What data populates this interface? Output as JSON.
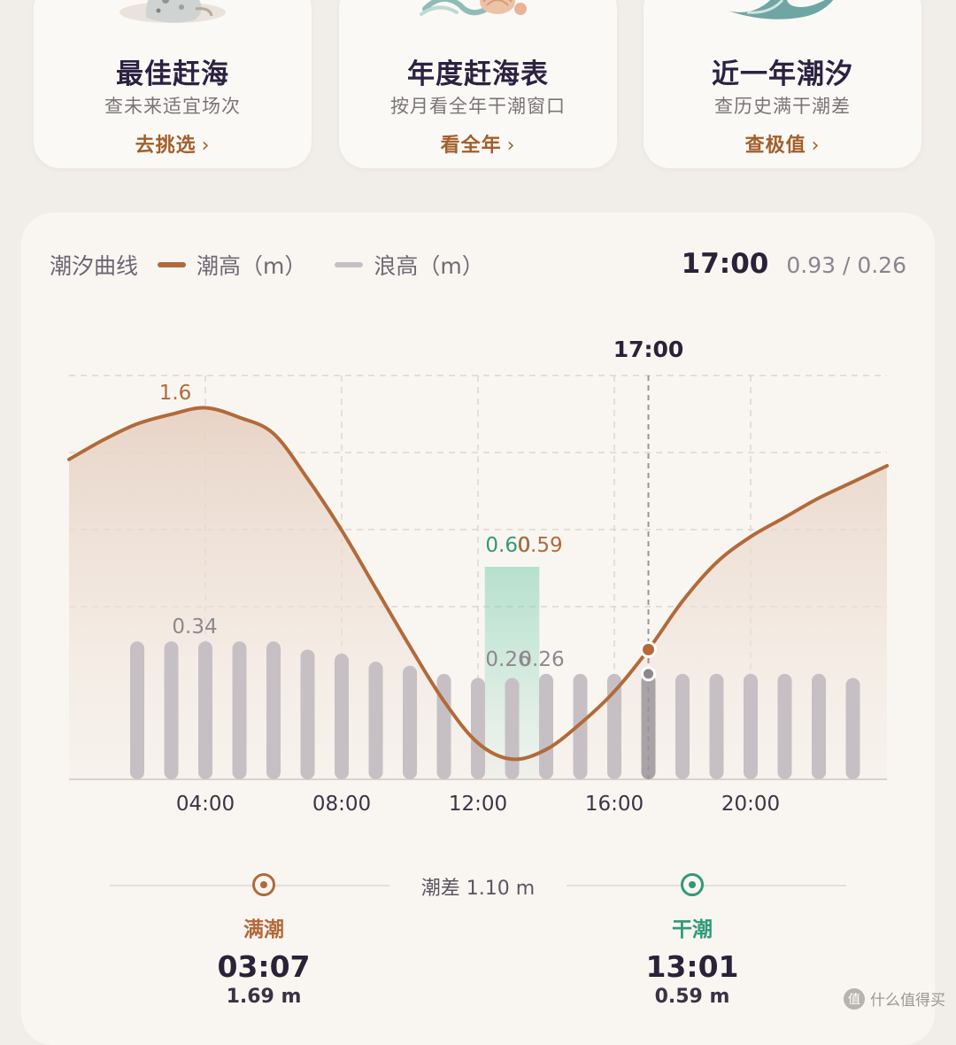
{
  "colors": {
    "tide": "#b26a3a",
    "wave": "#c6c0c4",
    "low": "#2f9a78",
    "high_text": "#a35f2b",
    "grid": "#dcd5ce"
  },
  "cards": [
    {
      "icon": "rock-icon",
      "title": "最佳赶海",
      "desc": "查未来适宜场次",
      "link": "去挑选",
      "chevron": "›"
    },
    {
      "icon": "shell-icon",
      "title": "年度赶海表",
      "desc": "按月看全年干潮窗口",
      "link": "看全年",
      "chevron": "›"
    },
    {
      "icon": "wave-icon",
      "title": "近一年潮汐",
      "desc": "查历史满干潮差",
      "link": "查极值",
      "chevron": "›"
    }
  ],
  "chart_header": {
    "title": "潮汐曲线",
    "legend_tide": "潮高（m）",
    "legend_wave": "浪高（m）",
    "time": "17:00",
    "values": "0.93 / 0.26"
  },
  "chart_data": {
    "type": "line",
    "x_ticks": [
      "04:00",
      "08:00",
      "12:00",
      "16:00",
      "20:00"
    ],
    "cursor_label": "17:00",
    "series": [
      {
        "name": "潮高（m）",
        "hours": [
          0,
          1,
          2,
          3,
          4,
          5,
          6,
          7,
          8,
          9,
          10,
          11,
          12,
          13,
          14,
          15,
          16,
          17,
          18,
          19,
          20,
          21,
          22,
          23,
          24
        ],
        "values": [
          1.52,
          1.58,
          1.63,
          1.66,
          1.68,
          1.65,
          1.6,
          1.46,
          1.3,
          1.12,
          0.94,
          0.77,
          0.64,
          0.59,
          0.62,
          0.7,
          0.8,
          0.93,
          1.08,
          1.2,
          1.28,
          1.34,
          1.4,
          1.45,
          1.5
        ]
      },
      {
        "name": "浪高（m）",
        "type": "bar",
        "hours": [
          2,
          3,
          4,
          5,
          6,
          7,
          8,
          9,
          10,
          11,
          12,
          13,
          14,
          15,
          16,
          17,
          18,
          19,
          20,
          21,
          22,
          23
        ],
        "values": [
          0.34,
          0.34,
          0.34,
          0.34,
          0.34,
          0.32,
          0.31,
          0.29,
          0.28,
          0.26,
          0.25,
          0.25,
          0.26,
          0.26,
          0.26,
          0.26,
          0.26,
          0.26,
          0.26,
          0.26,
          0.26,
          0.25
        ]
      }
    ],
    "annotations": {
      "high": {
        "hour": 4,
        "label": "1.6"
      },
      "low_tide_labels": [
        "0.60",
        "0.59"
      ],
      "wave_max_label": "0.34",
      "wave_min_labels": [
        "0.26",
        "0.26"
      ]
    },
    "cursor_hour": 17,
    "low_window_hours": [
      12.2,
      13.8
    ],
    "grid": true,
    "legend": "top-left"
  },
  "summary": {
    "diff": "潮差 1.10 m",
    "high": {
      "kind": "满潮",
      "time": "03:07",
      "height": "1.69 m"
    },
    "low": {
      "kind": "干潮",
      "time": "13:01",
      "height": "0.59 m"
    }
  },
  "watermark": {
    "logo": "值",
    "text": "什么值得买"
  }
}
